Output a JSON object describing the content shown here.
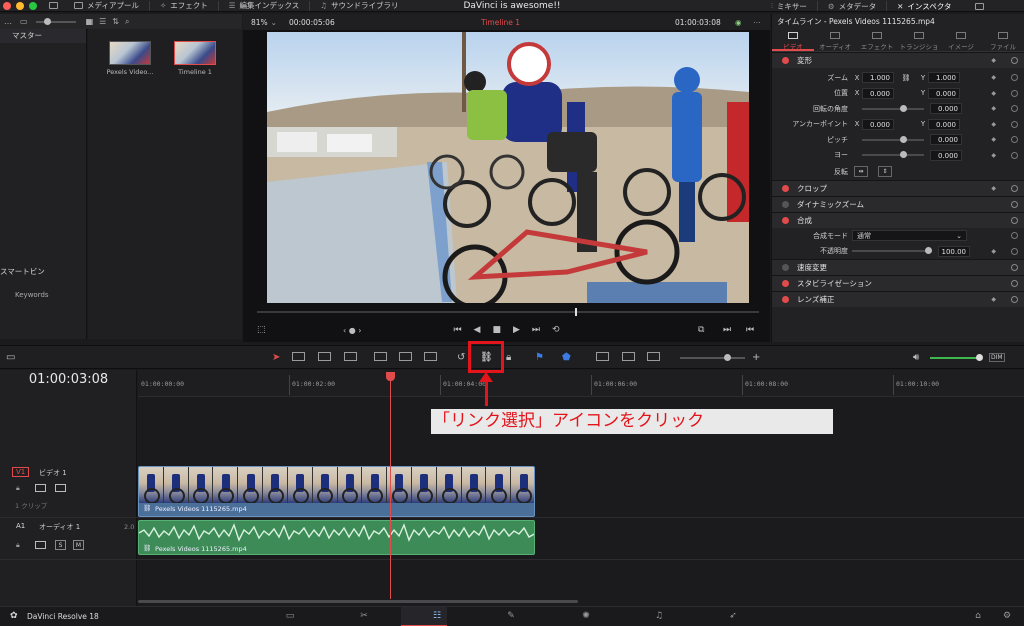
{
  "window": {
    "app_title": "DaVinci is awesome!!",
    "traffic_colors": [
      "#ff5f57",
      "#febc2e",
      "#28c840"
    ]
  },
  "topbar": {
    "left": [
      {
        "label": "メディアプール",
        "icon": "media-pool-icon"
      },
      {
        "label": "エフェクト",
        "icon": "effects-icon"
      },
      {
        "label": "編集インデックス",
        "icon": "edit-index-icon"
      },
      {
        "label": "サウンドライブラリ",
        "icon": "sound-library-icon"
      }
    ],
    "right": [
      {
        "label": "ミキサー",
        "icon": "mixer-icon"
      },
      {
        "label": "メタデータ",
        "icon": "metadata-icon"
      },
      {
        "label": "インスペクタ",
        "icon": "inspector-icon"
      }
    ]
  },
  "media_pool": {
    "bins_header": "マスター",
    "smart_bins_header": "スマートビン",
    "smart_bin_item": "Keywords",
    "clips": [
      {
        "name": "Pexels Video..."
      },
      {
        "name": "Timeline 1"
      }
    ]
  },
  "viewer": {
    "zoom": "81%",
    "source_tc": "00:00:05:06",
    "timeline_name": "Timeline 1",
    "record_tc": "01:00:03:08"
  },
  "inspector": {
    "title": "タイムライン - Pexels Videos 1115265.mp4",
    "tabs": [
      "ビデオ",
      "オーディオ",
      "エフェクト",
      "トランジション",
      "イメージ",
      "ファイル"
    ],
    "active_tab": 0,
    "transform": {
      "header": "変形",
      "zoom": {
        "label": "ズーム",
        "x": "1.000",
        "y": "1.000"
      },
      "position": {
        "label": "位置",
        "x": "0.000",
        "y": "0.000"
      },
      "rotation": {
        "label": "回転の角度",
        "value": "0.000"
      },
      "anchor": {
        "label": "アンカーポイント",
        "x": "0.000",
        "y": "0.000"
      },
      "pitch": {
        "label": "ピッチ",
        "value": "0.000"
      },
      "yaw": {
        "label": "ヨー",
        "value": "0.000"
      },
      "flip": {
        "label": "反転"
      }
    },
    "sections": [
      "クロップ",
      "ダイナミックズーム"
    ],
    "composite": {
      "header": "合成",
      "mode_label": "合成モード",
      "mode_value": "通常",
      "opacity_label": "不透明度",
      "opacity_value": "100.00"
    },
    "more_sections": [
      "速度変更",
      "スタビライゼーション",
      "レンズ補正"
    ],
    "accent": "#e24b4b"
  },
  "timeline": {
    "timecode": "01:00:03:08",
    "ruler_labels": [
      "01:00:00:00",
      "01:00:02:00",
      "01:00:04:00",
      "01:00:06:00",
      "01:00:08:00",
      "01:00:10:00"
    ],
    "video_track": {
      "id": "V1",
      "name": "ビデオ 1",
      "clip_count": "1 クリップ",
      "clip_name": "Pexels Videos 1115265.mp4"
    },
    "audio_track": {
      "id": "A1",
      "name": "オーディオ 1",
      "channels": "2.0",
      "solo": "S",
      "mute": "M",
      "clip_name": "Pexels Videos 1115265.mp4"
    },
    "dim_label": "DIM"
  },
  "annotation": {
    "caption": "「リンク選択」アイコンをクリック",
    "color": "#e3141c"
  },
  "bottombar": {
    "app_name": "DaVinci Resolve 18",
    "pages": [
      "media-page-icon",
      "cut-page-icon",
      "edit-page-icon",
      "fusion-page-icon",
      "color-page-icon",
      "fairlight-page-icon",
      "deliver-page-icon"
    ]
  }
}
